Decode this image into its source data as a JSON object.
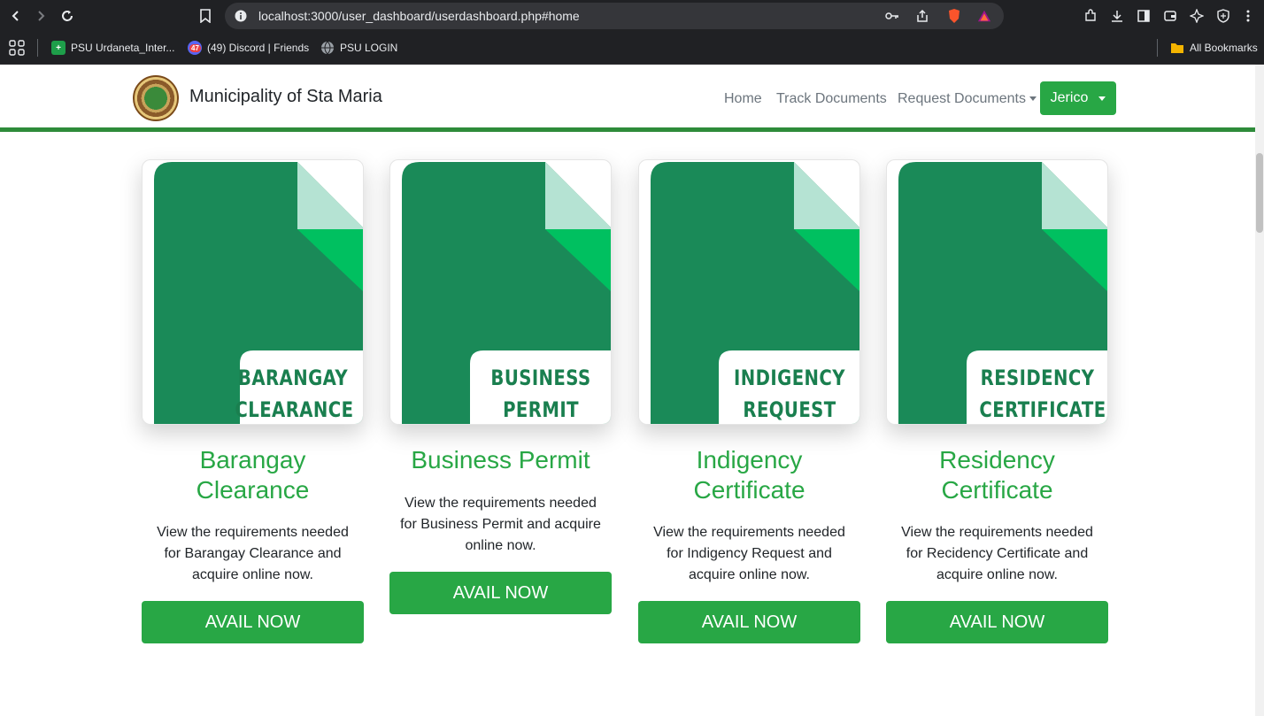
{
  "browser": {
    "url": "localhost:3000/user_dashboard/userdashboard.php#home",
    "bookmarks": [
      {
        "label": "PSU Urdaneta_Inter...",
        "icon": "green-plus-icon"
      },
      {
        "label": "(49) Discord | Friends",
        "icon": "discord-icon",
        "badge": "47"
      },
      {
        "label": "PSU LOGIN",
        "icon": "globe-icon"
      }
    ],
    "all_bookmarks": "All Bookmarks"
  },
  "navbar": {
    "brand": "Municipality of Sta Maria",
    "links": {
      "home": "Home",
      "track": "Track Documents",
      "request": "Request Documents"
    },
    "user": "Jerico"
  },
  "colors": {
    "accent": "#28a745",
    "doc_green": "#1a8a58",
    "doc_fold": "#00c060",
    "doc_corner": "#b5e3d3"
  },
  "cards": [
    {
      "doc_line1": "BARANGAY",
      "doc_line2": "CLEARANCE",
      "heading": "Barangay Clearance",
      "desc": "View the requirements needed for Barangay Clearance and acquire online now.",
      "button": "AVAIL NOW"
    },
    {
      "doc_line1": "BUSINESS",
      "doc_line2": "PERMIT",
      "heading": "Business Permit",
      "desc": "View the requirements needed for Business Permit and acquire online now.",
      "button": "AVAIL NOW"
    },
    {
      "doc_line1": "INDIGENCY",
      "doc_line2": "REQUEST",
      "heading": "Indigency Certificate",
      "desc": "View the requirements needed for Indigency Request and acquire online now.",
      "button": "AVAIL NOW"
    },
    {
      "doc_line1": "RESIDENCY",
      "doc_line2": "CERTIFICATE",
      "heading": "Residency Certificate",
      "desc": "View the requirements needed for Recidency Certificate and acquire online now.",
      "button": "AVAIL NOW"
    }
  ]
}
